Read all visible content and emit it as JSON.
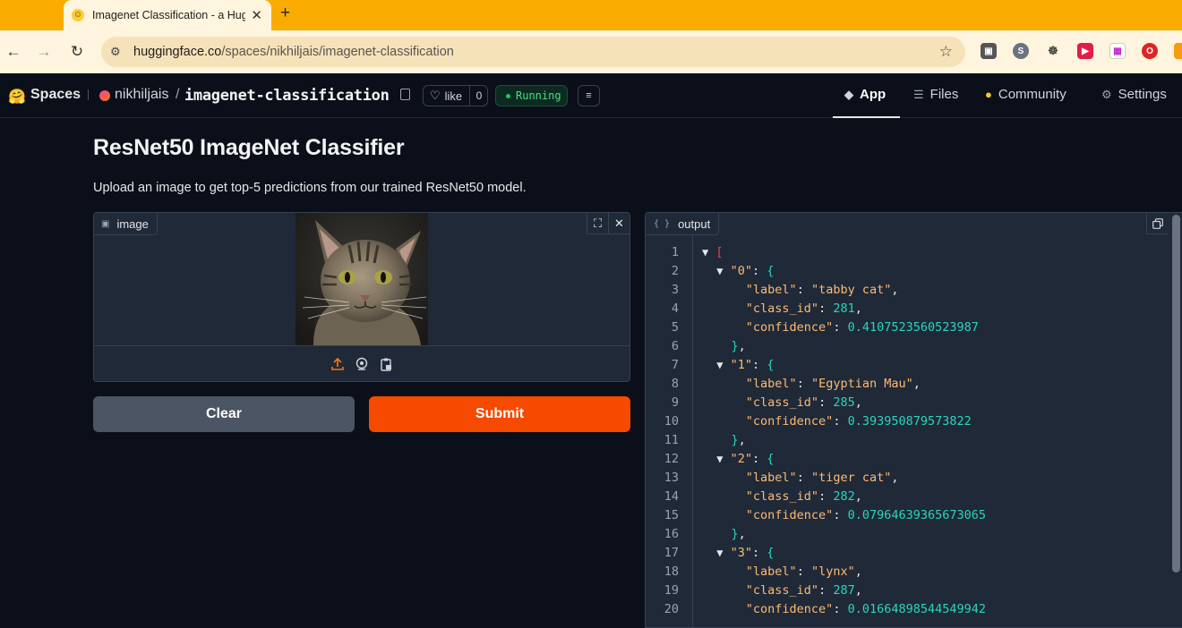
{
  "browser": {
    "tab_title": "Imagenet Classification - a Hugging Face Space",
    "url_host": "huggingface.co",
    "url_path": "/spaces/nikhiljais/imagenet-classification"
  },
  "header": {
    "spaces_label": "Spaces",
    "owner": "nikhiljais",
    "slash": "/",
    "repo": "imagenet-classification",
    "like_label": "like",
    "like_count": "0",
    "status": "Running",
    "nav": {
      "app": "App",
      "files": "Files",
      "community": "Community",
      "settings": "Settings"
    }
  },
  "main": {
    "title": "ResNet50 ImageNet Classifier",
    "description": "Upload an image to get top-5 predictions from our trained ResNet50 model.",
    "image_label": "image",
    "output_label": "output",
    "clear_label": "Clear",
    "submit_label": "Submit"
  },
  "output": {
    "line_numbers": [
      "1",
      "2",
      "3",
      "4",
      "5",
      "6",
      "7",
      "8",
      "9",
      "10",
      "11",
      "12",
      "13",
      "14",
      "15",
      "16",
      "17",
      "18",
      "19",
      "20"
    ],
    "predictions": [
      {
        "index": "\"0\"",
        "label": "\"tabby cat\"",
        "class_id": "281",
        "confidence": "0.4107523560523987"
      },
      {
        "index": "\"1\"",
        "label": "\"Egyptian Mau\"",
        "class_id": "285",
        "confidence": "0.393950879573822"
      },
      {
        "index": "\"2\"",
        "label": "\"tiger cat\"",
        "class_id": "282",
        "confidence": "0.07964639365673065"
      },
      {
        "index": "\"3\"",
        "label": "\"lynx\"",
        "class_id": "287",
        "confidence": "0.01664898544549942"
      }
    ],
    "keys": {
      "label": "\"label\"",
      "class_id": "\"class_id\"",
      "confidence": "\"confidence\""
    }
  },
  "colors": {
    "browser_accent": "#f9ab00",
    "submit": "#f54a00",
    "clear": "#4b5563",
    "running": "#22c55e"
  }
}
